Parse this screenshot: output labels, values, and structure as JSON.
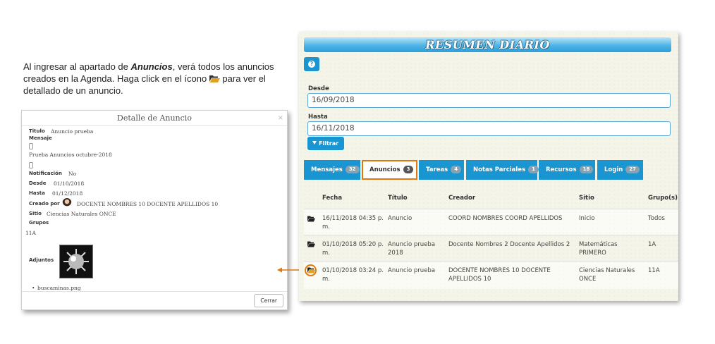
{
  "instructions": {
    "text_1": "Al ingresar al apartado de ",
    "text_bold": "Anuncios",
    "text_2": ", verá todos los anuncios creados en la Agenda. Haga click en el ícono ",
    "text_3": " para ver el detallado de un anuncio.",
    "icon": "folder-open-icon"
  },
  "modal": {
    "title": "Detalle de Anuncio",
    "close_glyph": "×",
    "titulo_label": "Titulo",
    "titulo_value": "Anuncio prueba",
    "mensaje_label": "Mensaje",
    "mensaje_value": "Prueba Anuncios octubre-2018",
    "notificacion_label": "Notificación",
    "notificacion_value": "No",
    "desde_label": "Desde",
    "desde_value": "01/10/2018",
    "hasta_label": "Hasta",
    "hasta_value": "01/12/2018",
    "creado_por_label": "Creado por",
    "creado_por_value": "DOCENTE NOMBRES 10 DOCENTE APELLIDOS 10",
    "sitio_label": "Sitio",
    "sitio_value": "Ciencias Naturales ONCE",
    "grupos_label": "Grupos",
    "grupos_value": "11A",
    "adjuntos_label": "Adjuntos",
    "adjunto_file": "buscaminas.png",
    "close_button": "Cerrar"
  },
  "panel": {
    "title": "RESUMEN DIARIO",
    "help_glyph": "?",
    "desde_label": "Desde",
    "desde_value": "16/09/2018",
    "hasta_label": "Hasta",
    "hasta_value": "16/11/2018",
    "filter_button": "Filtrar",
    "tabs": [
      {
        "label": "Mensajes",
        "count": "32"
      },
      {
        "label": "Anuncios",
        "count": "3"
      },
      {
        "label": "Tareas",
        "count": "4"
      },
      {
        "label": "Notas Parciales",
        "count": "1"
      },
      {
        "label": "Recursos",
        "count": "18"
      },
      {
        "label": "Login",
        "count": "27"
      }
    ],
    "columns": [
      "Fecha",
      "Título",
      "Creador",
      "Sitio",
      "Grupo(s)"
    ],
    "rows": [
      {
        "fecha_1": "16/11/2018 04:35 p.",
        "fecha_2": "m.",
        "titulo_1": "Anuncio",
        "titulo_2": "",
        "creador_1": "COORD NOMBRES COORD APELLIDOS",
        "creador_2": "",
        "sitio_1": "Inicio",
        "sitio_2": "",
        "grupo": "Todos"
      },
      {
        "fecha_1": "01/10/2018 05:20 p.",
        "fecha_2": "m.",
        "titulo_1": "Anuncio prueba",
        "titulo_2": "2018",
        "creador_1": "Docente Nombres 2 Docente Apellidos 2",
        "creador_2": "",
        "sitio_1": "Matemáticas",
        "sitio_2": "PRIMERO",
        "grupo": "1A"
      },
      {
        "fecha_1": "01/10/2018 03:24 p.",
        "fecha_2": "m.",
        "titulo_1": "Anuncio prueba",
        "titulo_2": "",
        "creador_1": "DOCENTE NOMBRES 10 DOCENTE",
        "creador_2": "APELLIDOS 10",
        "sitio_1": "Ciencias Naturales",
        "sitio_2": "ONCE",
        "grupo": "11A"
      }
    ]
  },
  "colors": {
    "accent": "#1996d2",
    "highlight": "#e0780f"
  }
}
